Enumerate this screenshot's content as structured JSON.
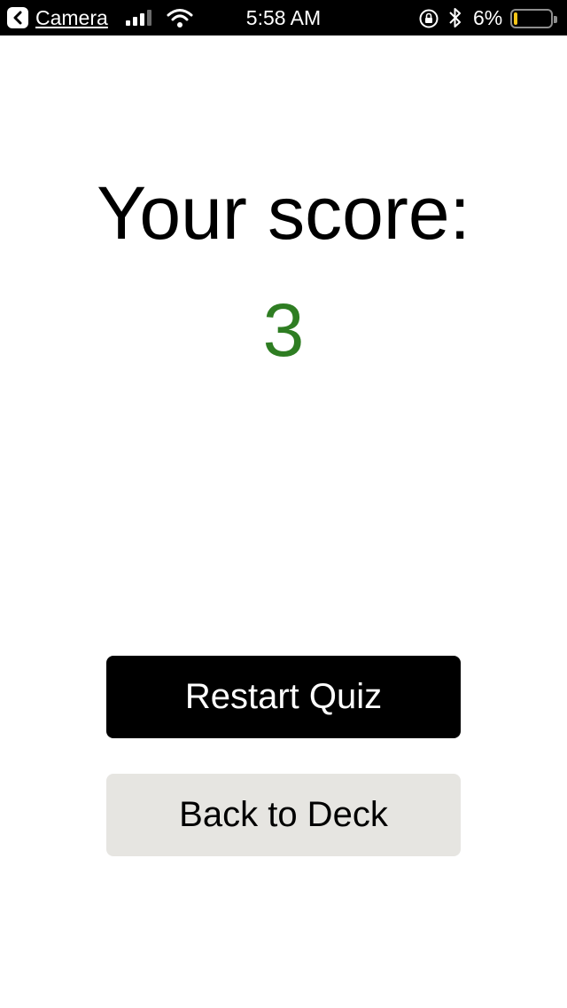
{
  "status_bar": {
    "back_app_label": "Camera",
    "time": "5:58 AM",
    "battery_percent": "6%",
    "battery_level": 0.06,
    "battery_color": "#f5c518",
    "icons": [
      "back-chevron-icon",
      "cellular-signal-icon",
      "wifi-icon",
      "rotation-lock-icon",
      "bluetooth-icon",
      "battery-icon"
    ]
  },
  "score": {
    "title": "Your score:",
    "value": "3",
    "value_color": "#2e7d22"
  },
  "buttons": {
    "restart_label": "Restart Quiz",
    "restart_bg": "#000000",
    "restart_fg": "#ffffff",
    "back_label": "Back to Deck",
    "back_bg": "#e6e5e1",
    "back_fg": "#000000"
  }
}
